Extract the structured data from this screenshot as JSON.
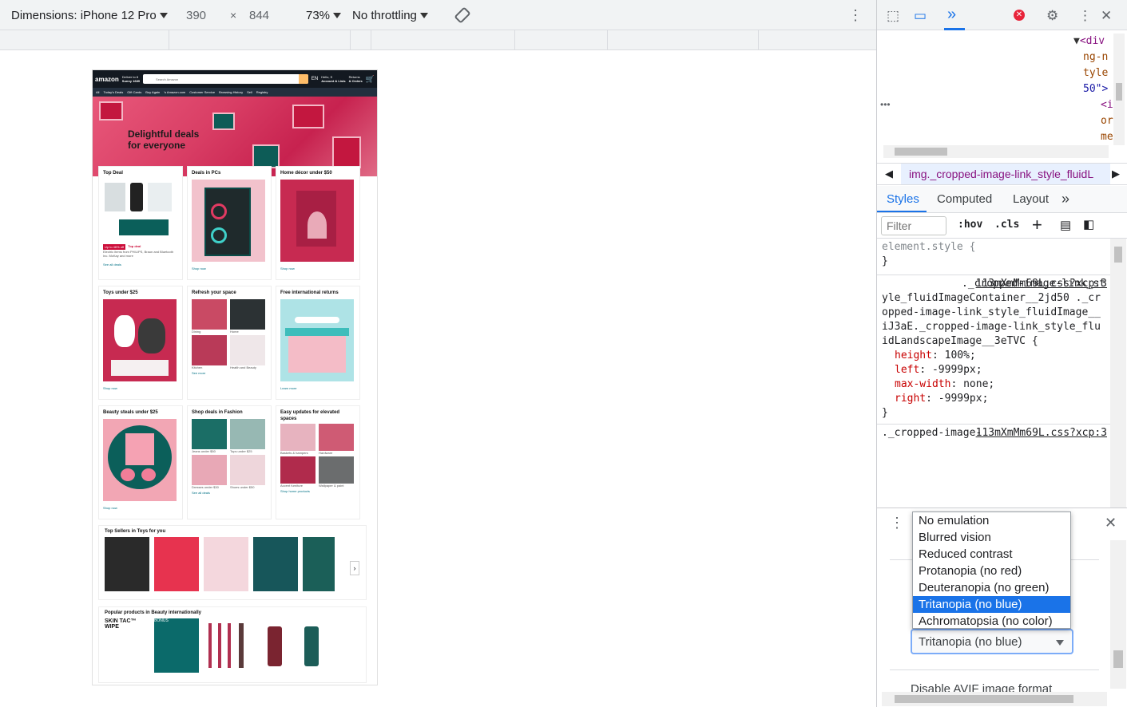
{
  "toolbar": {
    "dimensions_label": "Dimensions: iPhone 12 Pro",
    "width": "390",
    "times": "×",
    "height": "844",
    "zoom": "73%",
    "throttling": "No throttling"
  },
  "amazon": {
    "logo": "amazon",
    "deliver_line1": "Deliver to 8",
    "deliver_line2": "Sunny 1689",
    "search_placeholder": "Search Amazon",
    "lang": "EN",
    "account_line1": "Hello, S",
    "account_line2": "Account & Lists",
    "returns_line1": "Returns",
    "returns_line2": "& Orders",
    "nav": [
      "All",
      "Today's Deals",
      "Gift Cards",
      "Buy Again",
      "'s Amazon.com",
      "Customer Service",
      "Browsing History",
      "Sell",
      "Registry"
    ],
    "hero_text_1": "Delightful deals",
    "hero_text_2": "for everyone",
    "cards": [
      {
        "title": "Top Deal",
        "badge": "Up to 46% off",
        "badge2": "Top deal",
        "desc": "Electric items from PHILIPS, Braun and Bluetooth Inc. McKay and more",
        "link": "See all deals"
      },
      {
        "title": "Deals in PCs",
        "link": "Shop now"
      },
      {
        "title": "Home décor under $50",
        "link": "Shop now"
      },
      {
        "title": "Toys under $25",
        "link": "Shop now"
      },
      {
        "title": "Refresh your space",
        "link": "See more",
        "subs": [
          "Dining",
          "Home",
          "Kitchen",
          "Health and Beauty"
        ]
      },
      {
        "title": "Free international returns",
        "link": "Learn more"
      },
      {
        "title": "Beauty steals under $25",
        "link": "Shop now"
      },
      {
        "title": "Shop deals in Fashion",
        "link": "See all deals",
        "subs": [
          "Jeans under $50",
          "Tops under $25",
          "Dresses under $30",
          "Shoes under $50"
        ]
      },
      {
        "title": "Easy updates for elevated spaces",
        "link": "Shop home products",
        "subs": [
          "Baskets & hampers",
          "Hardware",
          "Accent furniture",
          "Wallpaper & paint"
        ]
      }
    ],
    "strip1_title": "Top Sellers in Toys for you",
    "strip2_title": "Popular products in Beauty internationally",
    "strip2_items": [
      "SKIN TAC™ WIPE",
      "BONUS"
    ]
  },
  "devtools": {
    "dom_lines": [
      "<div",
      "ng-n",
      "tyle",
      "50\">",
      "<ir",
      "or",
      "mec"
    ],
    "breadcrumb": "img._cropped-image-link_style_fluidL",
    "tabs": [
      "Styles",
      "Computed",
      "Layout"
    ],
    "filter_placeholder": "Filter",
    "hov": ":hov",
    "cls": ".cls",
    "element_style": "element.style {",
    "close_brace": "}",
    "rule1_src": "113mXmMm69L.css?xcp:3",
    "rule1_selector": "._cropped-image-link_style_fluidImageContainer__2jd50 ._cropped-image-link_style_fluidImage__iJ3aE._cropped-image-link_style_fluidLandscapeImage__3eTVC {",
    "rule1_props": [
      {
        "name": "height",
        "value": "100%;"
      },
      {
        "name": "left",
        "value": "-9999px;"
      },
      {
        "name": "max-width",
        "value": "none;"
      },
      {
        "name": "right",
        "value": "-9999px;"
      }
    ],
    "rule2_src": "113mXmMm69L.css?xcp:3",
    "rule2_selector": "._cropped-image-",
    "vision_options": [
      "No emulation",
      "Blurred vision",
      "Reduced contrast",
      "Protanopia (no red)",
      "Deuteranopia (no green)",
      "Tritanopia (no blue)",
      "Achromatopsia (no color)"
    ],
    "vision_selected": "Tritanopia (no blue)",
    "drawer_bottom": "Disable AVIF image format"
  },
  "colors": {
    "selected": "#1a73e8",
    "amazon_dark": "#131921",
    "devtools_blue": "#1a73e8"
  }
}
